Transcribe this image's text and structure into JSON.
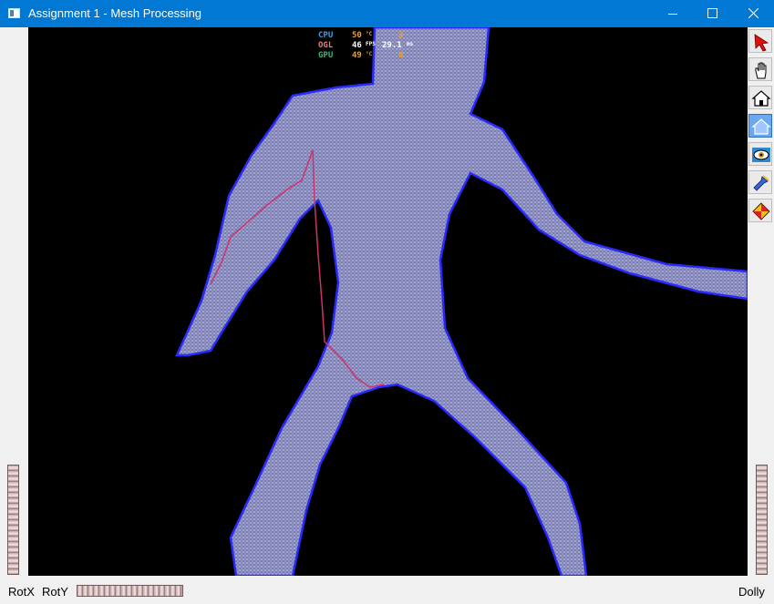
{
  "window": {
    "title": "Assignment 1 - Mesh Processing"
  },
  "stats_overlay": {
    "rows": [
      {
        "label": "CPU",
        "value": "50",
        "unit": "°C",
        "extra": "3",
        "label_color": "#3aa0e8"
      },
      {
        "label": "OGL",
        "value": "46",
        "unit": "FPS",
        "extra": "29.1",
        "extra_unit": "ms",
        "label_color": "#e08080"
      },
      {
        "label": "GPU",
        "value": "49",
        "unit": "°C",
        "extra": "0",
        "label_color": "#3ab87a"
      }
    ]
  },
  "toolbar": {
    "tools": [
      {
        "icon": "arrow-cursor-icon",
        "active": false
      },
      {
        "icon": "hand-icon",
        "active": false
      },
      {
        "icon": "home-icon",
        "active": false
      },
      {
        "icon": "home-outline-icon",
        "active": true
      },
      {
        "icon": "eye-icon",
        "active": false
      },
      {
        "icon": "flashlight-icon",
        "active": false
      },
      {
        "icon": "shading-cube-icon",
        "active": false
      }
    ]
  },
  "thumbwheels": {
    "rotx_label": "RotX",
    "roty_label": "RotY",
    "dolly_label": "Dolly"
  },
  "colors": {
    "titlebar": "#0078d4",
    "viewport_bg": "#000000",
    "mesh_fill": "#8d8fbf",
    "mesh_edge": "#2020ff",
    "path_curve": "#d0306a"
  }
}
